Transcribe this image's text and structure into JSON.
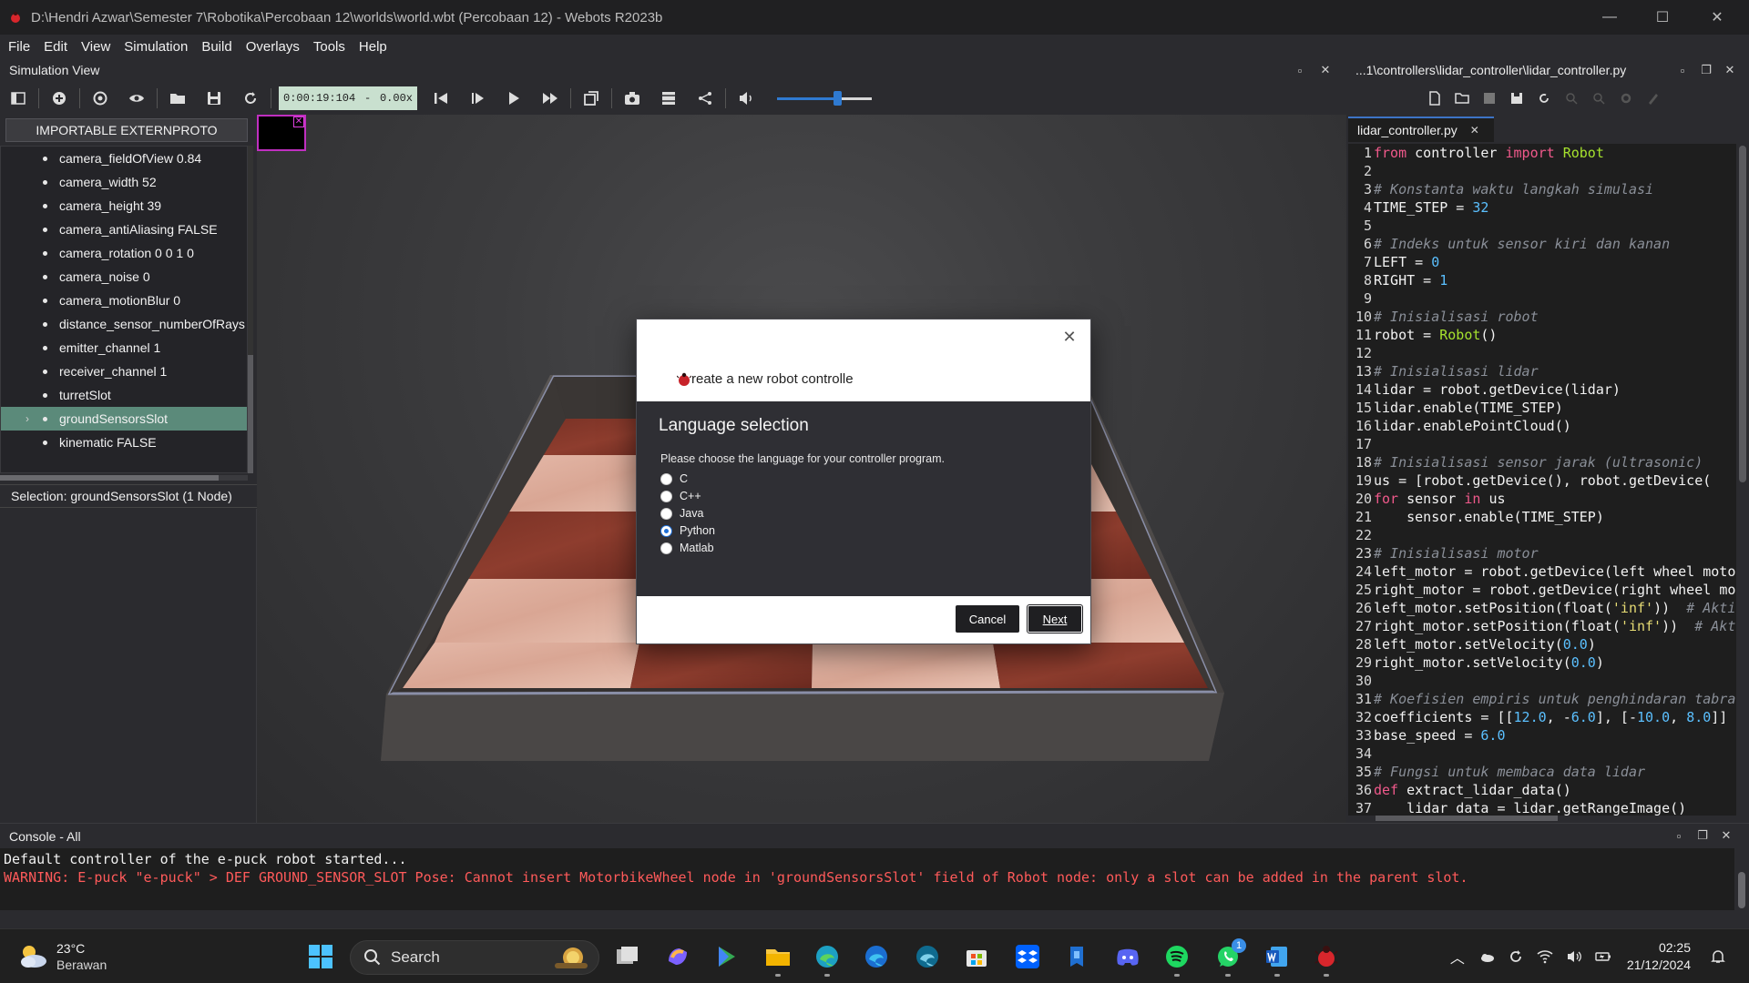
{
  "window": {
    "title": "D:\\Hendri Azwar\\Semester 7\\Robotika\\Percobaan 12\\worlds\\world.wbt (Percobaan 12) - Webots R2023b",
    "min": "—",
    "max": "☐",
    "close": "✕"
  },
  "menu": [
    "File",
    "Edit",
    "View",
    "Simulation",
    "Build",
    "Overlays",
    "Tools",
    "Help"
  ],
  "simulation_view": {
    "label": "Simulation View",
    "time": "0:00:19:104",
    "time_sep": "-",
    "speed": "0.00x",
    "volume_level": 0.63
  },
  "scene_tree": {
    "extern_button": "IMPORTABLE EXTERNPROTO",
    "items": [
      "camera_fieldOfView 0.84",
      "camera_width 52",
      "camera_height 39",
      "camera_antiAliasing FALSE",
      "camera_rotation 0 0 1 0",
      "camera_noise 0",
      "camera_motionBlur 0",
      "distance_sensor_numberOfRays",
      "emitter_channel 1",
      "receiver_channel 1",
      "turretSlot",
      "groundSensorsSlot",
      "kinematic FALSE"
    ],
    "selected_index": 11,
    "selection_status": "Selection: groundSensorsSlot (1 Node)"
  },
  "editor": {
    "path": "...1\\controllers\\lidar_controller\\lidar_controller.py",
    "tab": "lidar_controller.py",
    "tab_close": "✕",
    "lines": [
      "from controller import Robot",
      "",
      "# Konstanta waktu langkah simulasi",
      "TIME_STEP = 32",
      "",
      "# Indeks untuk sensor kiri dan kanan",
      "LEFT = 0",
      "RIGHT = 1",
      "",
      "# Inisialisasi robot",
      "robot = Robot()",
      "",
      "# Inisialisasi lidar",
      "lidar = robot.getDevice(lidar)",
      "lidar.enable(TIME_STEP)",
      "lidar.enablePointCloud()",
      "",
      "# Inisialisasi sensor jarak (ultrasonic)",
      "us = [robot.getDevice(us0), robot.getDevice(",
      "for sensor in us",
      "    sensor.enable(TIME_STEP)",
      "",
      "# Inisialisasi motor",
      "left_motor = robot.getDevice(left wheel moto",
      "right_motor = robot.getDevice(right wheel mo",
      "left_motor.setPosition(float('inf'))  # Akti",
      "right_motor.setPosition(float('inf'))  # Akt",
      "left_motor.setVelocity(0.0)",
      "right_motor.setVelocity(0.0)",
      "",
      "# Koefisien empiris untuk penghindaran tabra",
      "coefficients = [[12.0, -6.0], [-10.0, 8.0]]",
      "base_speed = 6.0",
      "",
      "# Fungsi untuk membaca data lidar",
      "def extract_lidar_data()",
      "    lidar_data = lidar.getRangeImage()"
    ]
  },
  "console": {
    "label": "Console - All",
    "lines": [
      {
        "type": "info",
        "text": "Default controller of the e-puck robot started..."
      },
      {
        "type": "warn",
        "text": "WARNING: E-puck \"e-puck\" > DEF GROUND_SENSOR_SLOT Pose: Cannot insert MotorbikeWheel node in 'groundSensorsSlot' field of Robot node: only a slot can be added in the parent slot."
      }
    ]
  },
  "dialog": {
    "title": "reate a new robot controlle",
    "close": "✕",
    "heading": "Language selection",
    "prompt": "Please choose the language for your controller program.",
    "options": [
      "C",
      "C++",
      "Java",
      "Python",
      "Matlab"
    ],
    "selected": "Python",
    "cancel": "Cancel",
    "next": "Next"
  },
  "taskbar": {
    "temperature": "23°C",
    "condition": "Berawan",
    "search": "Search",
    "notification_count": "1",
    "time": "02:25",
    "date": "21/12/2024",
    "apps": [
      "start-icon",
      "file-explorer-icon",
      "copilot-icon",
      "google-play-games-icon",
      "folder-icon",
      "edge-icon",
      "edge-beta-icon",
      "edge-dev-icon",
      "microsoft-store-icon",
      "dropbox-icon",
      "keyboard-app-icon",
      "discord-icon",
      "spotify-icon",
      "whatsapp-icon",
      "word-icon",
      "webots-icon"
    ]
  },
  "colors": {
    "accent": "#2f7ad1",
    "selection": "#5b8a7a",
    "warning": "#ff5a5a",
    "time_box": "#c9e0cf"
  }
}
